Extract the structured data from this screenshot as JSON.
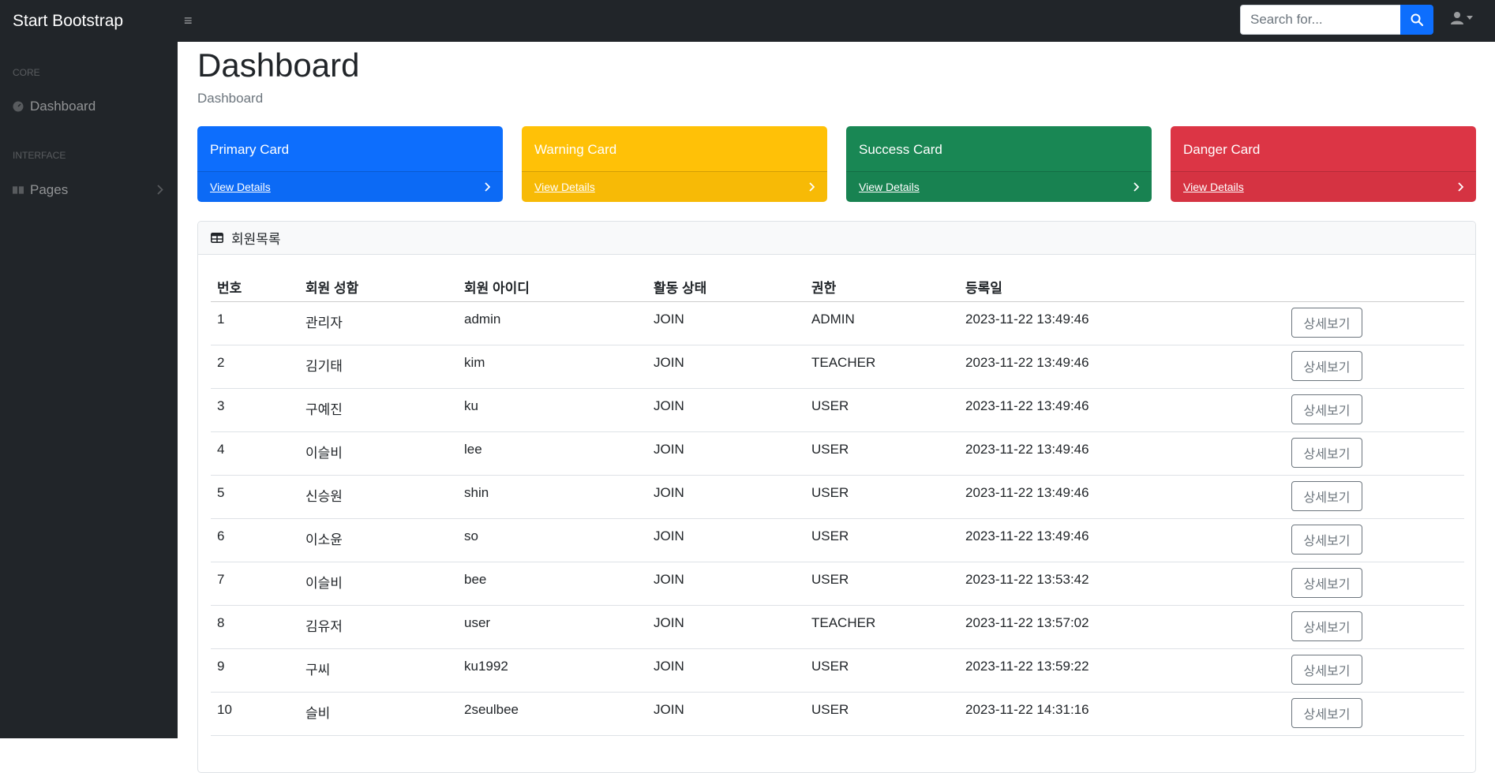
{
  "navbar": {
    "brand": "Start Bootstrap",
    "search_placeholder": "Search for..."
  },
  "sidebar": {
    "heading_core": "CORE",
    "dashboard_label": "Dashboard",
    "heading_interface": "INTERFACE",
    "pages_label": "Pages"
  },
  "main": {
    "title": "Dashboard",
    "breadcrumb": "Dashboard"
  },
  "cards": [
    {
      "title": "Primary Card",
      "link": "View Details",
      "color": "#0d6efd"
    },
    {
      "title": "Warning Card",
      "link": "View Details",
      "color": "#ffc107"
    },
    {
      "title": "Success Card",
      "link": "View Details",
      "color": "#198754"
    },
    {
      "title": "Danger Card",
      "link": "View Details",
      "color": "#dc3545"
    }
  ],
  "member_table": {
    "title": "회원목록",
    "columns": [
      "번호",
      "회원 성함",
      "회원 아이디",
      "활동 상태",
      "권한",
      "등록일"
    ],
    "button_label": "상세보기",
    "rows": [
      [
        "1",
        "관리자",
        "admin",
        "JOIN",
        "ADMIN",
        "2023-11-22 13:49:46"
      ],
      [
        "2",
        "김기태",
        "kim",
        "JOIN",
        "TEACHER",
        "2023-11-22 13:49:46"
      ],
      [
        "3",
        "구예진",
        "ku",
        "JOIN",
        "USER",
        "2023-11-22 13:49:46"
      ],
      [
        "4",
        "이슬비",
        "lee",
        "JOIN",
        "USER",
        "2023-11-22 13:49:46"
      ],
      [
        "5",
        "신승원",
        "shin",
        "JOIN",
        "USER",
        "2023-11-22 13:49:46"
      ],
      [
        "6",
        "이소윤",
        "so",
        "JOIN",
        "USER",
        "2023-11-22 13:49:46"
      ],
      [
        "7",
        "이슬비",
        "bee",
        "JOIN",
        "USER",
        "2023-11-22 13:53:42"
      ],
      [
        "8",
        "김유저",
        "user",
        "JOIN",
        "TEACHER",
        "2023-11-22 13:57:02"
      ],
      [
        "9",
        "구씨",
        "ku1992",
        "JOIN",
        "USER",
        "2023-11-22 13:59:22"
      ],
      [
        "10",
        "슬비",
        "2seulbee",
        "JOIN",
        "USER",
        "2023-11-22 14:31:16"
      ]
    ]
  }
}
